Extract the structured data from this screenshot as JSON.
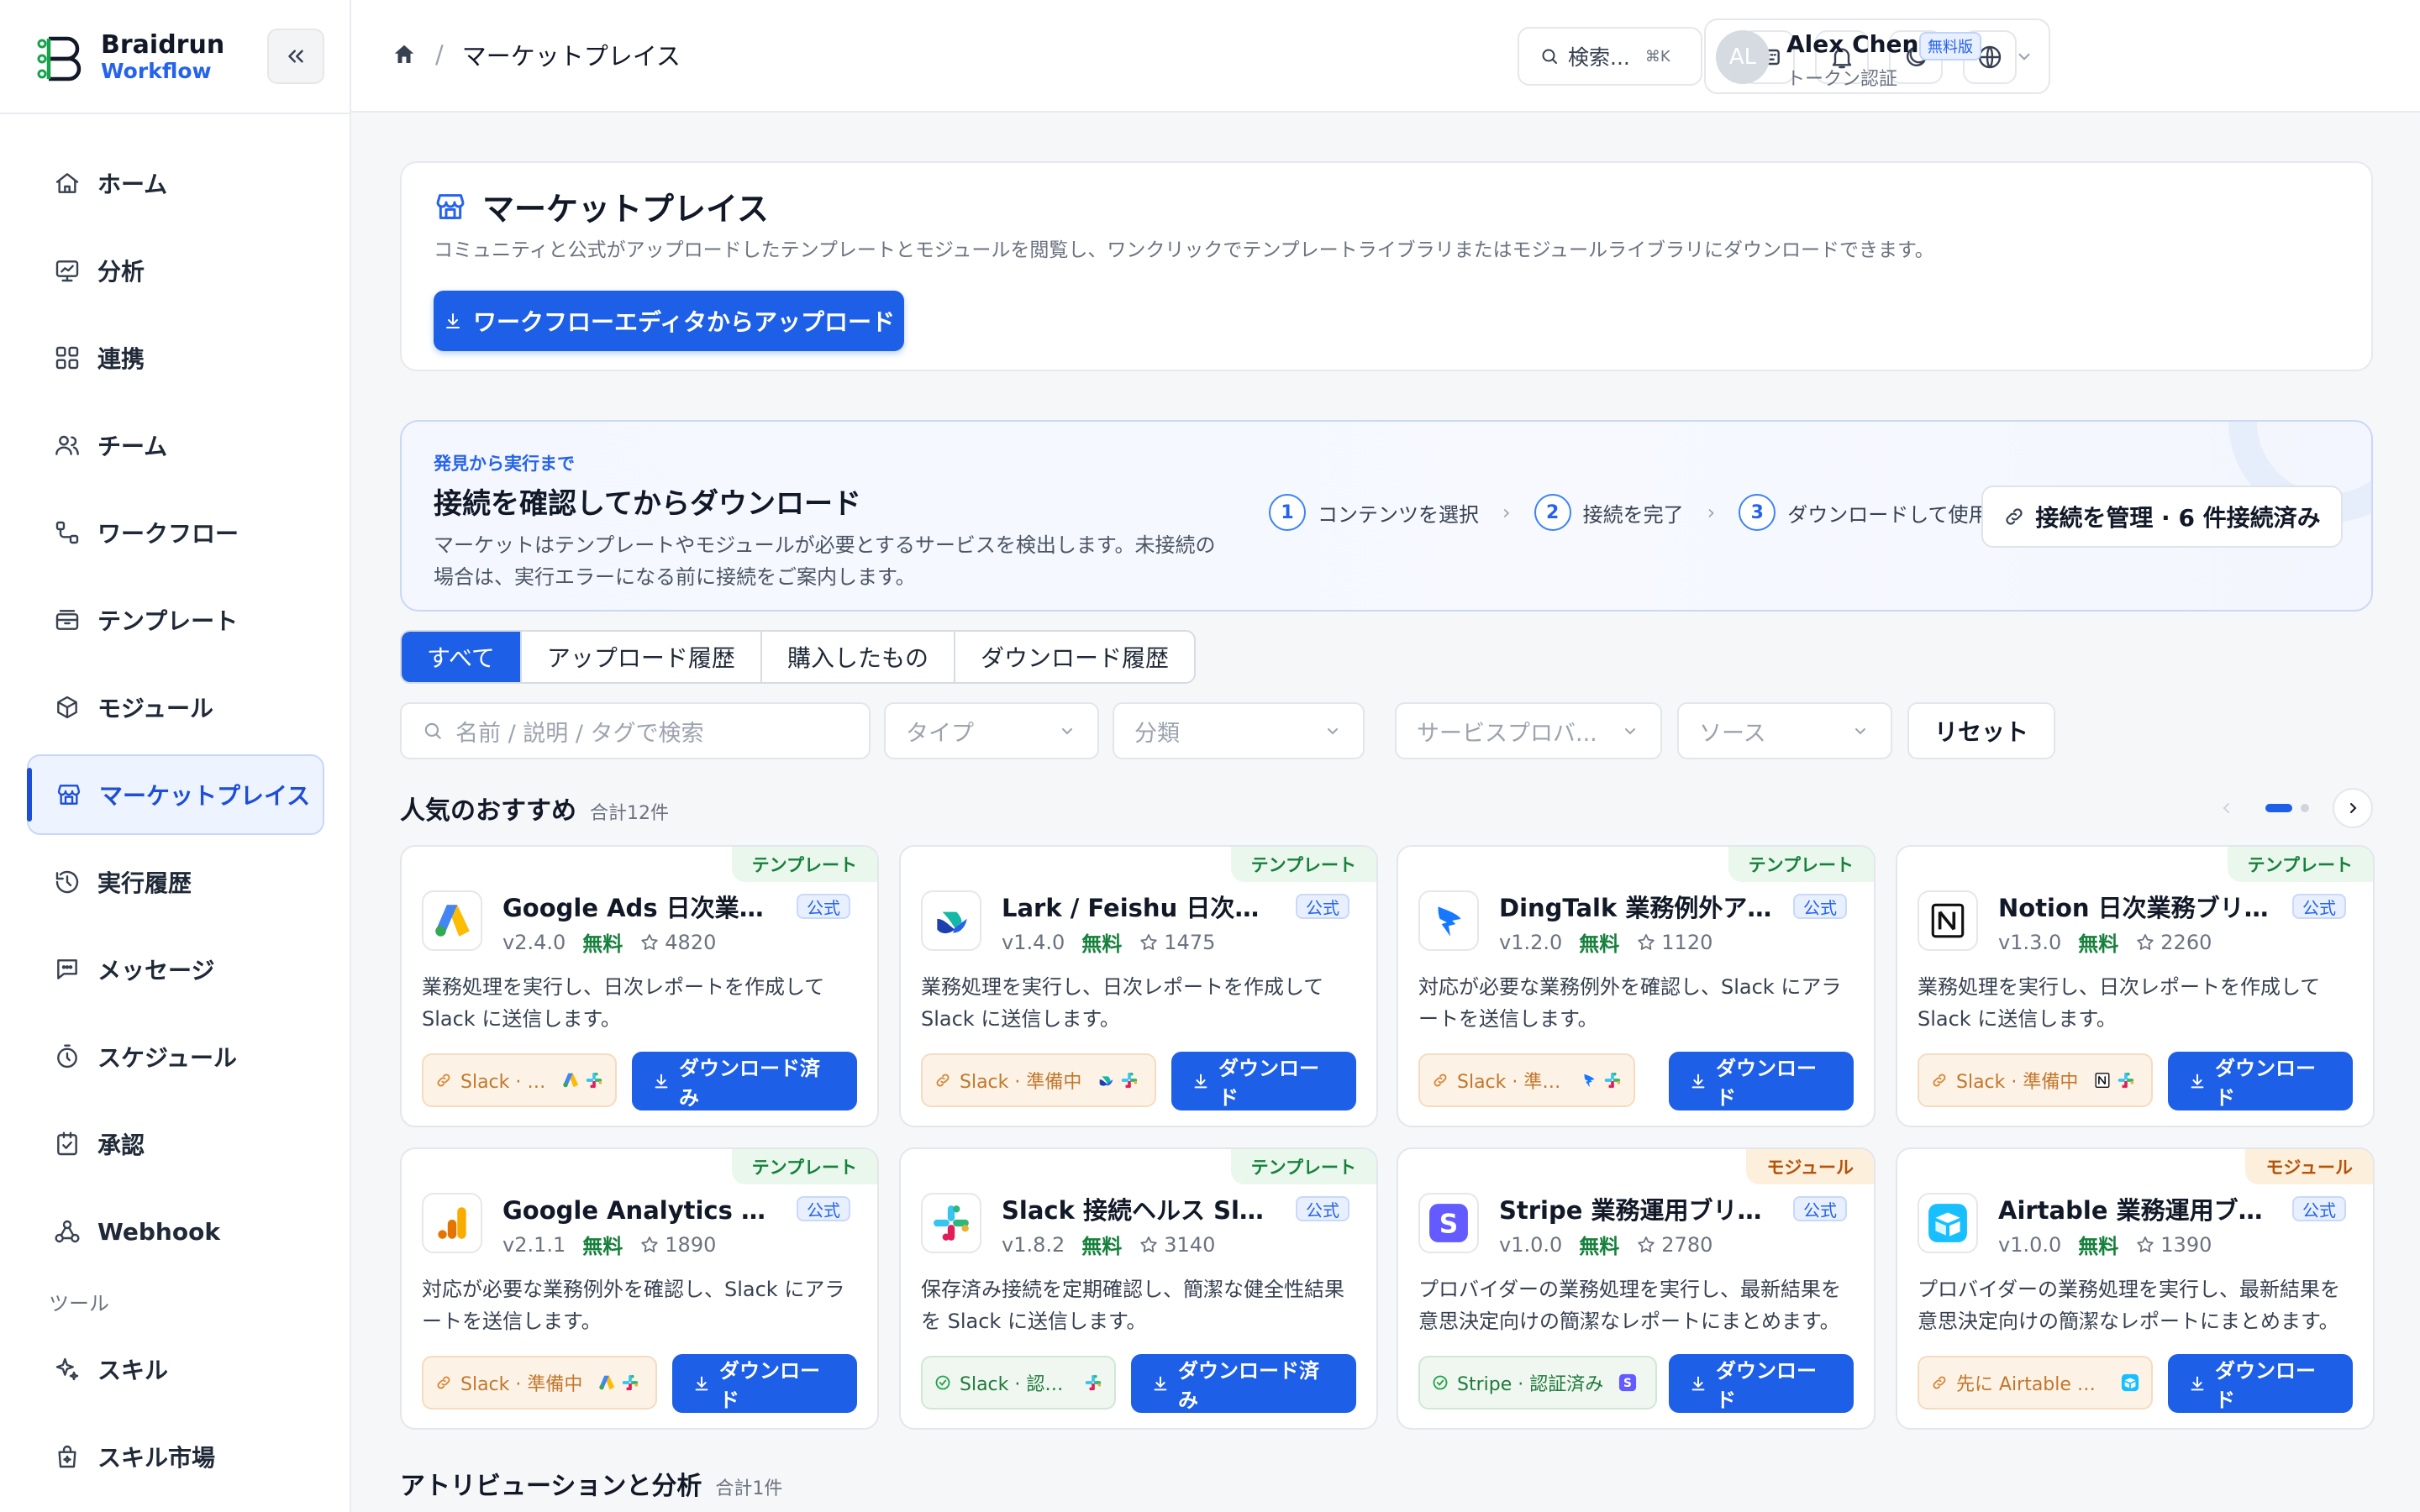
{
  "brand": {
    "name": "Braidrun",
    "sub": "Workflow"
  },
  "sidebar": {
    "items": [
      {
        "label": "ホーム",
        "icon": "home-icon"
      },
      {
        "label": "分析",
        "icon": "analytics-icon"
      },
      {
        "label": "連携",
        "icon": "integrations-icon"
      },
      {
        "label": "チーム",
        "icon": "team-icon"
      },
      {
        "label": "ワークフロー",
        "icon": "workflow-icon"
      },
      {
        "label": "テンプレート",
        "icon": "template-icon"
      },
      {
        "label": "モジュール",
        "icon": "module-icon"
      },
      {
        "label": "マーケットプレイス",
        "icon": "store-icon",
        "active": true
      },
      {
        "label": "実行履歴",
        "icon": "history-icon"
      },
      {
        "label": "メッセージ",
        "icon": "message-icon"
      },
      {
        "label": "スケジュール",
        "icon": "timer-icon"
      },
      {
        "label": "承認",
        "icon": "approval-icon"
      },
      {
        "label": "Webhook",
        "icon": "webhook-icon"
      }
    ],
    "section_tools": "ツール",
    "tools": [
      {
        "label": "スキル",
        "icon": "skill-icon"
      },
      {
        "label": "スキル市場",
        "icon": "skill-market-icon"
      }
    ]
  },
  "header": {
    "breadcrumb": "マーケットプレイス",
    "search_label": "検索...",
    "search_shortcut": "⌘K",
    "user": {
      "initials": "AL",
      "name": "Alex Chen",
      "plan": "無料版",
      "auth": "トークン認証"
    }
  },
  "hero": {
    "title": "マーケットプレイス",
    "description": "コミュニティと公式がアップロードしたテンプレートとモジュールを閲覧し、ワンクリックでテンプレートライブラリまたはモジュールライブラリにダウンロードできます。",
    "upload_button": "ワークフローエディタからアップロード"
  },
  "flow": {
    "eyebrow": "発見から実行まで",
    "title": "接続を確認してからダウンロード",
    "desc_line1": "マーケットはテンプレートやモジュールが必要とするサービスを検出します。未接続の",
    "desc_line2": "場合は、実行エラーになる前に接続をご案内します。",
    "steps": [
      {
        "num": "1",
        "label": "コンテンツを選択"
      },
      {
        "num": "2",
        "label": "接続を完了"
      },
      {
        "num": "3",
        "label": "ダウンロードして使用"
      }
    ],
    "manage_button": "接続を管理 · 6 件接続済み"
  },
  "tabs": [
    "すべて",
    "アップロード履歴",
    "購入したもの",
    "ダウンロード履歴"
  ],
  "filters": {
    "search_placeholder": "名前 / 説明 / タグで検索",
    "type": "タイプ",
    "category": "分類",
    "provider": "サービスプロバ...",
    "source": "ソース",
    "reset": "リセット"
  },
  "popular": {
    "title": "人気のおすすめ",
    "count": "合計12件"
  },
  "attribution": {
    "title": "アトリビューションと分析",
    "count": "合計1件"
  },
  "cards": [
    {
      "type": "テンプレート",
      "kind": "template",
      "logo": "google-ads-logo",
      "title": "Google Ads 日次業務ブリーフ",
      "official": "公式",
      "version": "v2.4.0",
      "price": "無料",
      "stars": "4820",
      "desc": "業務処理を実行し、日次レポートを作成して Slack に送信します。",
      "chip": "Slack · 準備中",
      "chip_state": "warn",
      "chip_logos": [
        "google-ads-logo",
        "slack-logo"
      ],
      "button": "ダウンロード済み"
    },
    {
      "type": "テンプレート",
      "kind": "template",
      "logo": "lark-logo",
      "title": "Lark / Feishu 日次業務ブリーフ",
      "official": "公式",
      "version": "v1.4.0",
      "price": "無料",
      "stars": "1475",
      "desc": "業務処理を実行し、日次レポートを作成して Slack に送信します。",
      "chip": "Slack · 準備中",
      "chip_state": "warn",
      "chip_logos": [
        "lark-logo",
        "slack-logo"
      ],
      "button": "ダウンロード"
    },
    {
      "type": "テンプレート",
      "kind": "template",
      "logo": "dingtalk-logo",
      "title": "DingTalk 業務例外アラート",
      "official": "公式",
      "version": "v1.2.0",
      "price": "無料",
      "stars": "1120",
      "desc": "対応が必要な業務例外を確認し、Slack にアラートを送信します。",
      "chip": "Slack · 準備中",
      "chip_state": "warn",
      "chip_logos": [
        "dingtalk-logo",
        "slack-logo"
      ],
      "button": "ダウンロード"
    },
    {
      "type": "テンプレート",
      "kind": "template",
      "logo": "notion-logo",
      "title": "Notion 日次業務ブリーフ",
      "official": "公式",
      "version": "v1.3.0",
      "price": "無料",
      "stars": "2260",
      "desc": "業務処理を実行し、日次レポートを作成して Slack に送信します。",
      "chip": "Slack · 準備中",
      "chip_state": "warn",
      "chip_logos": [
        "notion-logo",
        "slack-logo"
      ],
      "button": "ダウンロード"
    },
    {
      "type": "テンプレート",
      "kind": "template",
      "logo": "google-analytics-logo",
      "title": "Google Analytics 業務例外アラート",
      "official": "公式",
      "version": "v2.1.1",
      "price": "無料",
      "stars": "1890",
      "desc": "対応が必要な業務例外を確認し、Slack にアラートを送信します。",
      "chip": "Slack · 準備中",
      "chip_state": "warn",
      "chip_logos": [
        "google-ads-logo",
        "slack-logo"
      ],
      "button": "ダウンロード"
    },
    {
      "type": "テンプレート",
      "kind": "template",
      "logo": "slack-logo",
      "title": "Slack 接続ヘルス Slack レポート",
      "official": "公式",
      "version": "v1.8.2",
      "price": "無料",
      "stars": "3140",
      "desc": "保存済み接続を定期確認し、簡潔な健全性結果を Slack に送信します。",
      "chip": "Slack · 認証済み",
      "chip_state": "ok",
      "chip_logos": [
        "slack-logo"
      ],
      "button": "ダウンロード済み"
    },
    {
      "type": "モジュール",
      "kind": "module",
      "logo": "stripe-logo",
      "title": "Stripe 業務運用ブリーフ",
      "official": "公式",
      "version": "v1.0.0",
      "price": "無料",
      "stars": "2780",
      "desc": "プロバイダーの業務処理を実行し、最新結果を意思決定向けの簡潔なレポートにまとめます。",
      "chip": "Stripe · 認証済み",
      "chip_state": "ok",
      "chip_logos": [
        "stripe-logo"
      ],
      "button": "ダウンロード"
    },
    {
      "type": "モジュール",
      "kind": "module",
      "logo": "airtable-logo",
      "title": "Airtable 業務運用ブリーフ",
      "official": "公式",
      "version": "v1.0.0",
      "price": "無料",
      "stars": "1390",
      "desc": "プロバイダーの業務処理を実行し、最新結果を意思決定向けの簡潔なレポートにまとめます。",
      "chip": "先に Airtable を接続",
      "chip_state": "warn",
      "chip_logos": [
        "airtable-logo"
      ],
      "button": "ダウンロード"
    }
  ]
}
